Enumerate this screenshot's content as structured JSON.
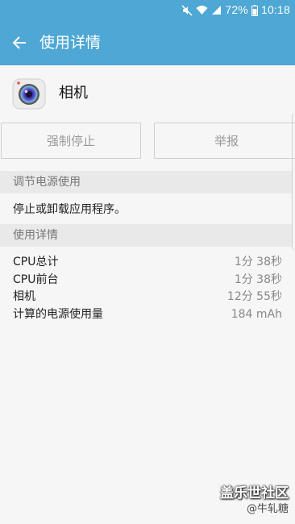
{
  "status_bar": {
    "icons": [
      "mute-icon",
      "wifi-icon",
      "signal-icon",
      "battery-icon"
    ],
    "battery": "72%",
    "time": "10:18"
  },
  "app_bar": {
    "title": "使用详情"
  },
  "app": {
    "name": "相机",
    "icon": "camera-icon"
  },
  "actions": {
    "force_stop": "强制停止",
    "report": "举报"
  },
  "power_section": {
    "header": "调节电源使用",
    "description": "停止或卸载应用程序。"
  },
  "usage_section": {
    "header": "使用详情",
    "rows": [
      {
        "label": "CPU总计",
        "value": "1分 38秒"
      },
      {
        "label": "CPU前台",
        "value": "1分 38秒"
      },
      {
        "label": "相机",
        "value": "12分 55秒"
      },
      {
        "label": "计算的电源使用量",
        "value": "184 mAh"
      }
    ]
  },
  "watermark": {
    "line1": "盖乐世社区",
    "line2": "@牛轧糖"
  },
  "colors": {
    "accent": "#4ea7d4",
    "background": "#f6f6f6",
    "section_bg": "#e9e9e9"
  }
}
